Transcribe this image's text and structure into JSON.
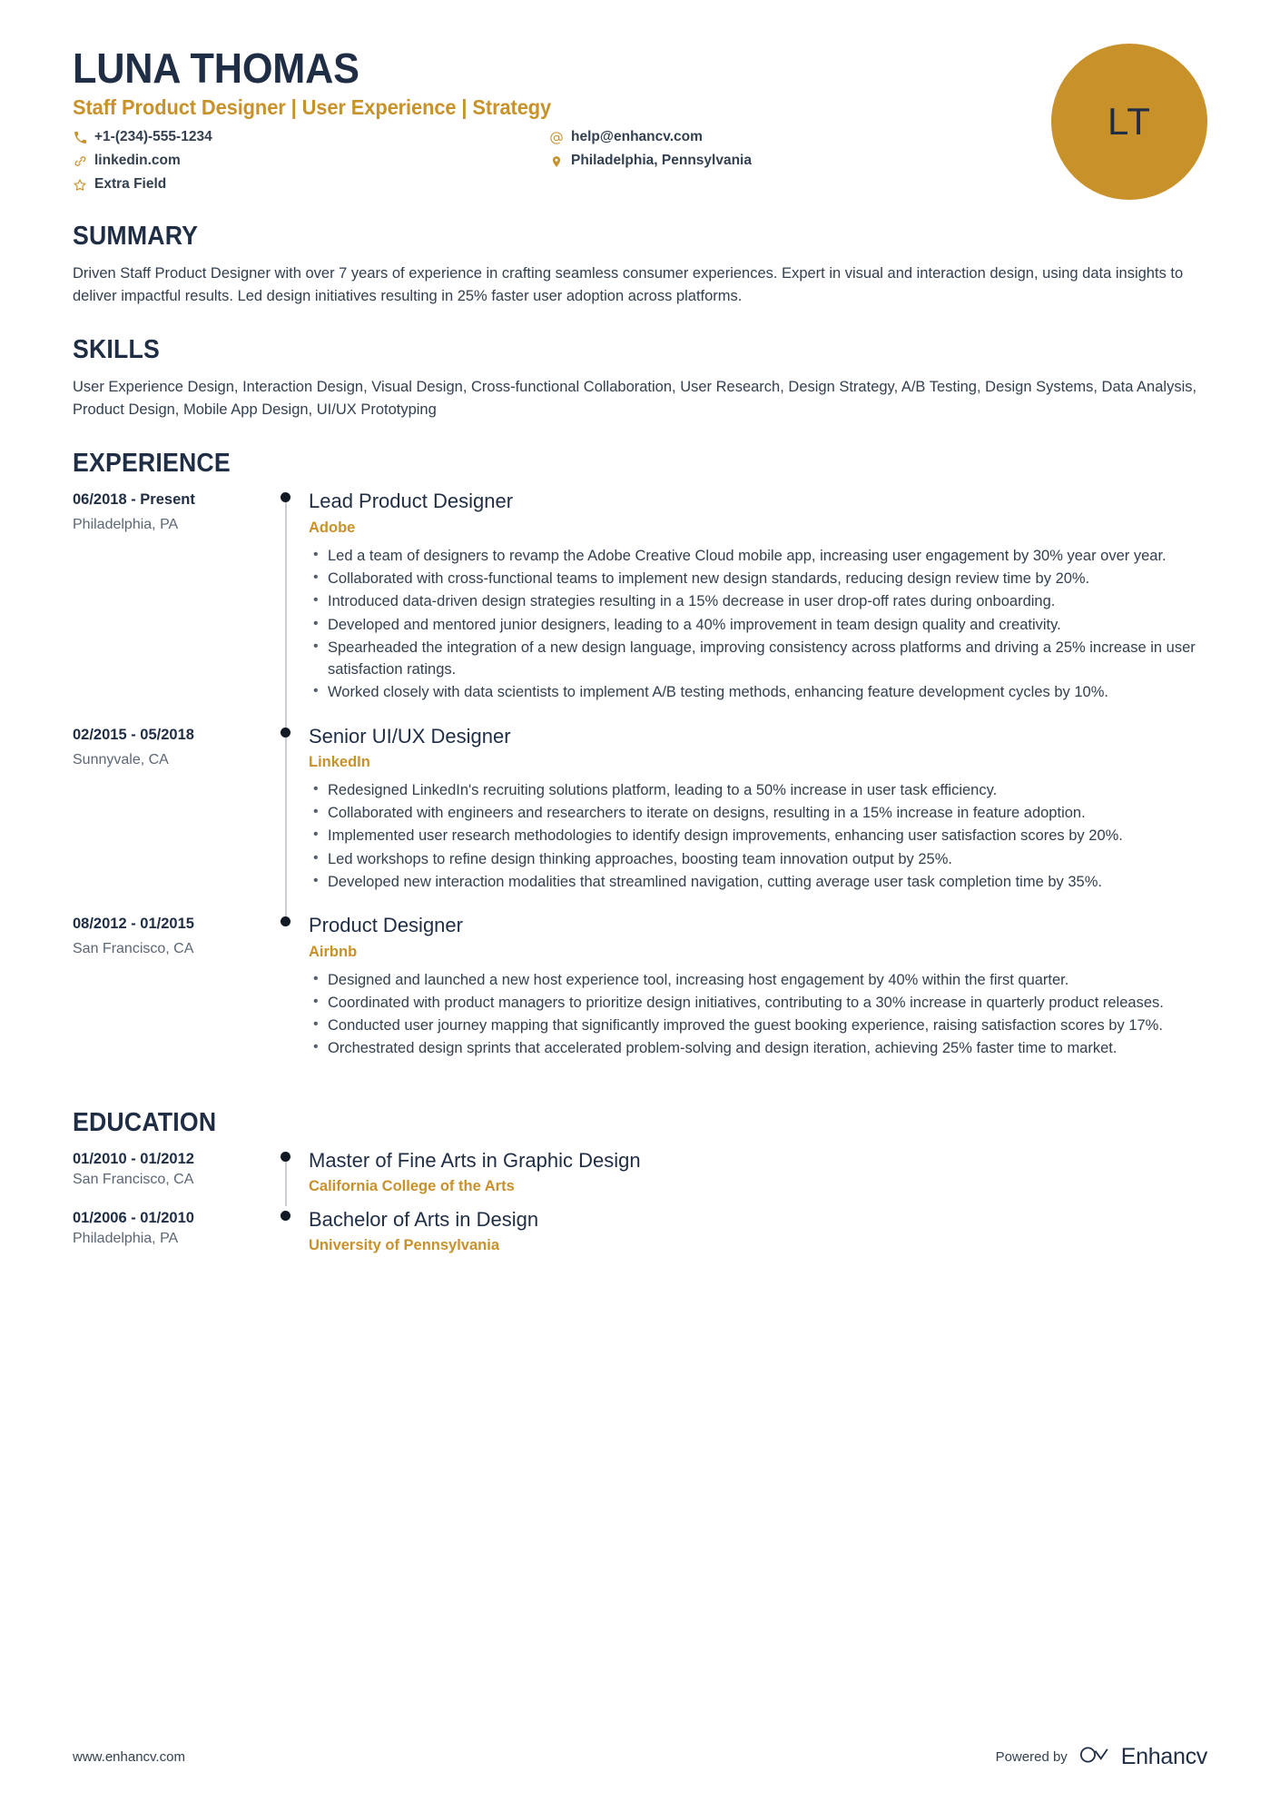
{
  "header": {
    "name": "LUNA THOMAS",
    "role": "Staff Product Designer | User Experience | Strategy",
    "avatar_initials": "LT",
    "avatar_color": "#C8912A",
    "accent_color": "#C8912A",
    "heading_color": "#1F2D45",
    "contacts": [
      {
        "icon": "phone-icon",
        "text": "+1-(234)-555-1234"
      },
      {
        "icon": "at-icon",
        "text": "help@enhancv.com"
      },
      {
        "icon": "link-icon",
        "text": "linkedin.com"
      },
      {
        "icon": "location-icon",
        "text": "Philadelphia, Pennsylvania"
      },
      {
        "icon": "star-icon",
        "text": "Extra Field"
      }
    ]
  },
  "summary": {
    "title": "SUMMARY",
    "text": "Driven Staff Product Designer with over 7 years of experience in crafting seamless consumer experiences. Expert in visual and interaction design, using data insights to deliver impactful results. Led design initiatives resulting in 25% faster user adoption across platforms."
  },
  "skills": {
    "title": "SKILLS",
    "text": "User Experience Design, Interaction Design, Visual Design, Cross-functional Collaboration, User Research, Design Strategy, A/B Testing, Design Systems, Data Analysis, Product Design, Mobile App Design, UI/UX Prototyping"
  },
  "experience": {
    "title": "EXPERIENCE",
    "entries": [
      {
        "date": "06/2018 - Present",
        "location": "Philadelphia, PA",
        "title": "Lead Product Designer",
        "org": "Adobe",
        "bullets": [
          "Led a team of designers to revamp the Adobe Creative Cloud mobile app, increasing user engagement by 30% year over year.",
          "Collaborated with cross-functional teams to implement new design standards, reducing design review time by 20%.",
          "Introduced data-driven design strategies resulting in a 15% decrease in user drop-off rates during onboarding.",
          "Developed and mentored junior designers, leading to a 40% improvement in team design quality and creativity.",
          "Spearheaded the integration of a new design language, improving consistency across platforms and driving a 25% increase in user satisfaction ratings.",
          "Worked closely with data scientists to implement A/B testing methods, enhancing feature development cycles by 10%."
        ]
      },
      {
        "date": "02/2015 - 05/2018",
        "location": "Sunnyvale, CA",
        "title": "Senior UI/UX Designer",
        "org": "LinkedIn",
        "bullets": [
          "Redesigned LinkedIn's recruiting solutions platform, leading to a 50% increase in user task efficiency.",
          "Collaborated with engineers and researchers to iterate on designs, resulting in a 15% increase in feature adoption.",
          "Implemented user research methodologies to identify design improvements, enhancing user satisfaction scores by 20%.",
          "Led workshops to refine design thinking approaches, boosting team innovation output by 25%.",
          "Developed new interaction modalities that streamlined navigation, cutting average user task completion time by 35%."
        ]
      },
      {
        "date": "08/2012 - 01/2015",
        "location": "San Francisco, CA",
        "title": "Product Designer",
        "org": "Airbnb",
        "bullets": [
          "Designed and launched a new host experience tool, increasing host engagement by 40% within the first quarter.",
          "Coordinated with product managers to prioritize design initiatives, contributing to a 30% increase in quarterly product releases.",
          "Conducted user journey mapping that significantly improved the guest booking experience, raising satisfaction scores by 17%.",
          "Orchestrated design sprints that accelerated problem-solving and design iteration, achieving 25% faster time to market."
        ]
      }
    ]
  },
  "education": {
    "title": "EDUCATION",
    "entries": [
      {
        "date": "01/2010 - 01/2012",
        "location": "San Francisco, CA",
        "title": "Master of Fine Arts in Graphic Design",
        "org": "California College of the Arts"
      },
      {
        "date": "01/2006 - 01/2010",
        "location": "Philadelphia, PA",
        "title": "Bachelor of Arts in Design",
        "org": "University of Pennsylvania"
      }
    ]
  },
  "footer": {
    "url": "www.enhancv.com",
    "powered_by": "Powered by",
    "brand": "Enhancv"
  }
}
